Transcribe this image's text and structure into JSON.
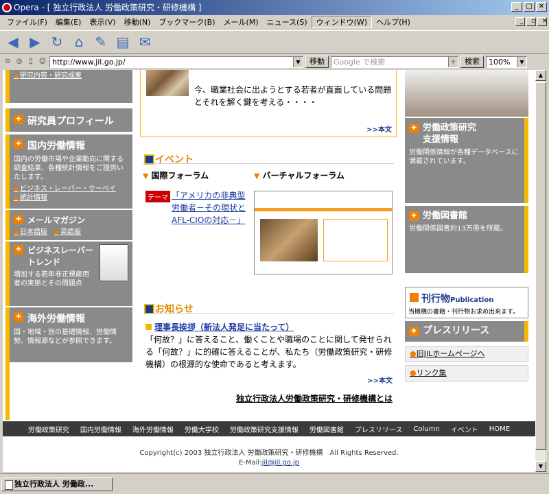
{
  "window": {
    "title": "Opera - [ 独立行政法人 労働政策研究・研修機構 ]"
  },
  "menu": [
    "ファイル(F)",
    "編集(E)",
    "表示(V)",
    "移動(N)",
    "ブックマーク(B)",
    "メール(M)",
    "ニュース(S)",
    "ウィンドウ(W)",
    "ヘルプ(H)"
  ],
  "address": {
    "url": "http://www.jil.go.jp/",
    "go_label": "移動",
    "search_placeholder": "Google で検索",
    "search_label": "検索",
    "zoom": "100%"
  },
  "left": {
    "top_links": "研究内容・研究成果",
    "profile": "研究員プロフィール",
    "domestic": {
      "title": "国内労働情報",
      "text": "国内の労働市場や企業動向に関する調査結果、各種統計情報をご提供いたします。",
      "links": [
        "ビジネス・レーバー・サーベイ",
        "統計情報"
      ]
    },
    "mail": {
      "title": "メールマガジン",
      "links": [
        "日本語版",
        "英語版"
      ]
    },
    "trend": {
      "title": "ビジネスレーバー トレンド",
      "text": "増加する若年非正規雇用者の実態とその問題点"
    },
    "overseas": {
      "title": "海外労働情報",
      "text": "国・地域・別の基礎情報、労働情勢、情報源などが参照できます。"
    }
  },
  "center": {
    "top_text": "今、職業社会に出ようとする若者が直面している問題とそれを解く鍵を考える・・・・",
    "more": ">>本文",
    "event": {
      "title": "イベント",
      "intl": "国際フォーラム",
      "virtual": "バーチャルフォーラム",
      "theme_tag": "テーマ",
      "theme_text": "「アメリカの非典型労働者－その現状とAFL-CIOの対応－」"
    },
    "news": {
      "title": "お知らせ",
      "headline": "理事長挨拶（新法人発足に当たって）",
      "body": "「何故？」に答えること、働くことや職場のことに関して発せられる「何故？」に的確に答えることが、私たち（労働政策研究・研修機構）の根源的な使命であると考えます。",
      "more": ">>本文",
      "about": "独立行政法人労働政策研究・研修機構とは"
    }
  },
  "right": {
    "support": {
      "title": "労働政策研究 支援情報",
      "text": "労働関係情報が各種データベースに満載されています。"
    },
    "library": {
      "title": "労働図書館",
      "text": "労働関係図書約13万冊を所蔵。"
    },
    "publication": {
      "title": "刊行物",
      "title_en": "Publication",
      "text": "当機構の書籍・刊行物お求め出来ます。"
    },
    "press": {
      "title": "プレスリリース"
    },
    "links": [
      "旧JILホームページへ",
      "リンク集"
    ]
  },
  "footer": {
    "nav": [
      "労働政策研究",
      "国内労働情報",
      "海外労働情報",
      "労働大学校",
      "労働政策研究支援情報",
      "労働図書館",
      "プレスリリース",
      "Column",
      "イベント",
      "HOME"
    ],
    "copyright": "Copyright(c) 2003 独立行政法人 労働政策研究・研修機構　All Rights Reserved.",
    "email_label": "E-Mail:",
    "email": "jil@jil.go.jp"
  },
  "status": {
    "tab": "独立行政法人 労働政..."
  }
}
